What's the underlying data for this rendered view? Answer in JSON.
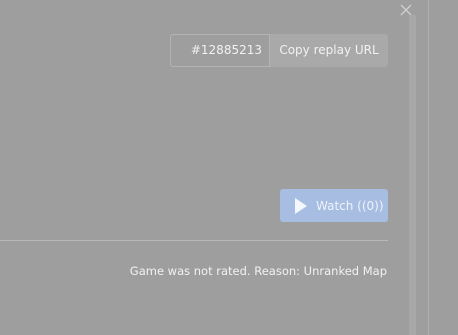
{
  "window": {
    "close_icon": "close-icon"
  },
  "replay": {
    "id": "#12885213",
    "copy_label": "Copy replay URL"
  },
  "watch": {
    "icon": "play-icon",
    "label": "Watch ((0))",
    "color": "#a7bde1"
  },
  "status": {
    "text": "Game was not rated. Reason: Unranked Map"
  },
  "colors": {
    "background": "#9e9e9e",
    "text": "#f2f2f2"
  }
}
